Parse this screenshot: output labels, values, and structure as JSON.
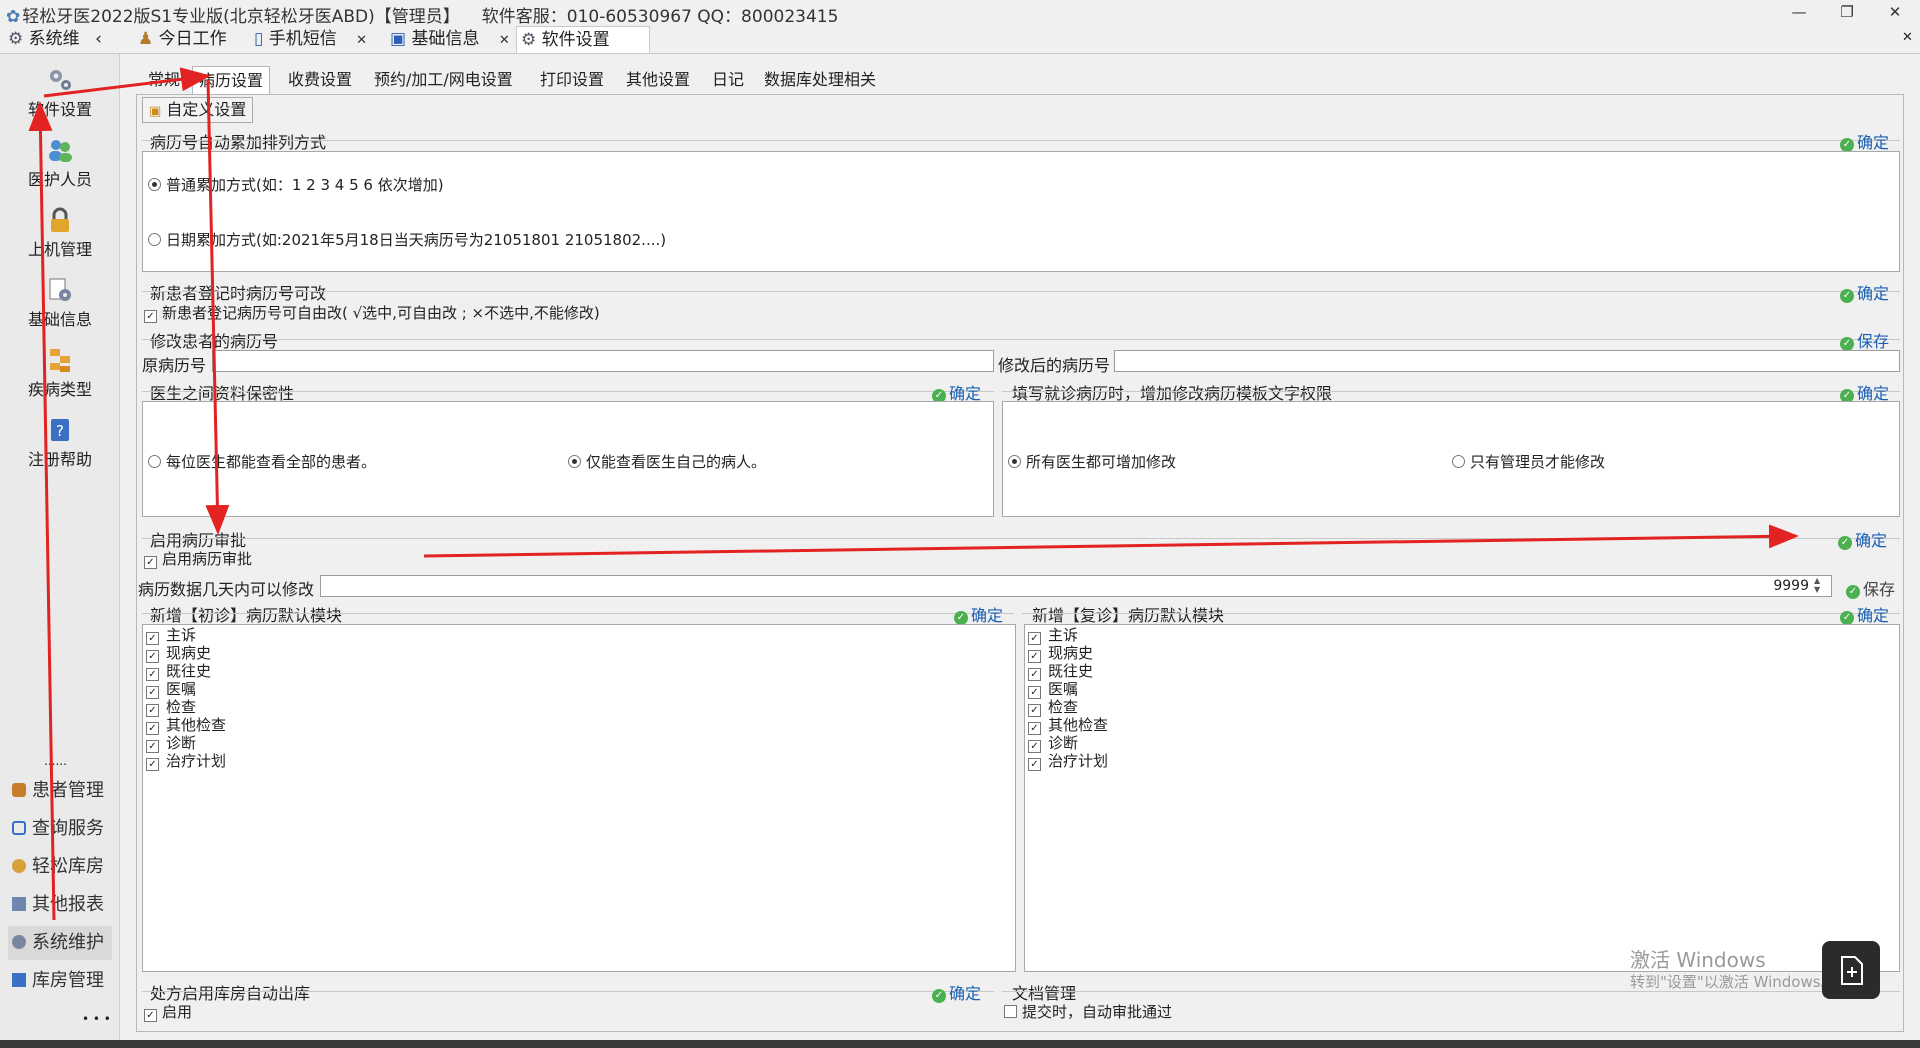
{
  "window": {
    "title": "轻松牙医2022版S1专业版(北京轻松牙医ABD)【管理员】",
    "support": "软件客服：010-60530967 QQ：800023415"
  },
  "tabs": {
    "module": "系统维",
    "today": "今日工作",
    "sms": "手机短信",
    "basic": "基础信息",
    "settings": "软件设置"
  },
  "sidebar": {
    "items": [
      "软件设置",
      "医护人员",
      "上机管理",
      "基础信息",
      "疾病类型",
      "注册帮助"
    ],
    "dots": "......",
    "nav": [
      "患者管理",
      "查询服务",
      "轻松库房",
      "其他报表",
      "系统维护",
      "库房管理"
    ],
    "more": "• • •"
  },
  "subtabs": [
    "常规",
    "病历设置",
    "收费设置",
    "预约/加工/网电设置",
    "打印设置",
    "其他设置",
    "日记",
    "数据库处理相关"
  ],
  "custom_btn": "自定义设置",
  "confirm": "确定",
  "save": "保存",
  "g1": {
    "title": "病历号自动累加排列方式",
    "opt1": "普通累加方式(如：1  2  3  4  5  6 依次增加)",
    "opt2": "日期累加方式(如:2021年5月18日当天病历号为21051801 21051802....)"
  },
  "g2": {
    "title": "新患者登记时病历号可改",
    "cb": "新患者登记病历号可自由改( √选中,可自由改 ;  ×不选中,不能修改)"
  },
  "g3": {
    "title": "修改患者的病历号",
    "orig": "原病历号",
    "new": "修改后的病历号"
  },
  "g4": {
    "title": "医生之间资料保密性",
    "opt1": "每位医生都能查看全部的患者。",
    "opt2": "仅能查看医生自己的病人。"
  },
  "g5": {
    "title": "填写就诊病历时，增加修改病历模板文字权限",
    "opt1": "所有医生都可增加修改",
    "opt2": "只有管理员才能修改"
  },
  "g6": {
    "title": "启用病历审批",
    "cb": "启用病历审批"
  },
  "g7": {
    "label": "病历数据几天内可以修改",
    "value": "9999"
  },
  "g8": {
    "title": "新增【初诊】病历默认模块",
    "items": [
      "主诉",
      "现病史",
      "既往史",
      "医嘱",
      "检查",
      "其他检查",
      "诊断",
      "治疗计划"
    ]
  },
  "g9": {
    "title": "新增【复诊】病历默认模块",
    "items": [
      "主诉",
      "现病史",
      "既往史",
      "医嘱",
      "检查",
      "其他检查",
      "诊断",
      "治疗计划"
    ]
  },
  "g10": {
    "title": "处方启用库房自动出库",
    "cb": "启用"
  },
  "g11": {
    "title": "文档管理",
    "cb": "提交时，自动审批通过"
  },
  "watermark": {
    "line1": "激活 Windows",
    "line2": "转到\"设置\"以激活 Windows。"
  }
}
